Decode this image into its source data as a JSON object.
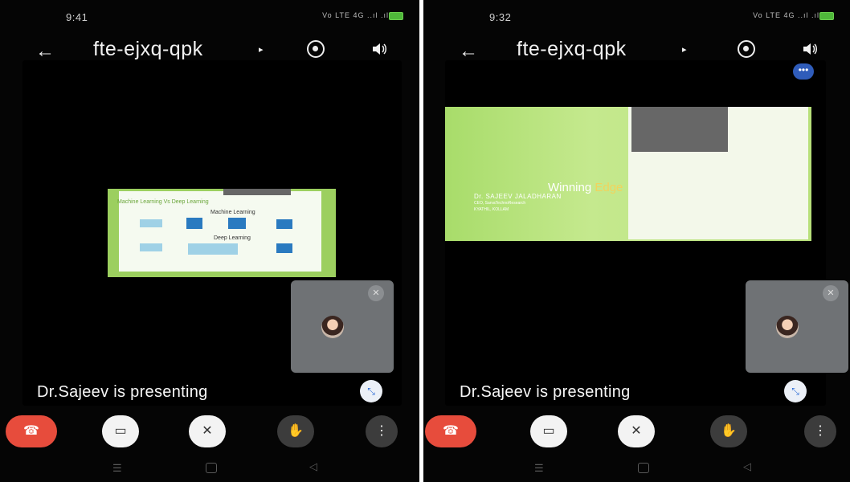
{
  "left": {
    "status": {
      "time": "9:41",
      "signal_text": "Vo LTE 4G ..ıl .ıl"
    },
    "meeting_code": "fte-ejxq-qpk",
    "title_caret": "▸",
    "slide": {
      "heading": "Machine Learning Vs Deep Learning",
      "row1_label": "Machine Learning",
      "row2_label": "Deep Learning"
    },
    "presenting_text": "Dr.Sajeev is presenting"
  },
  "right": {
    "status": {
      "time": "9:32",
      "signal_text": "Vo LTE 4G ..ıl .ıl"
    },
    "meeting_code": "fte-ejxq-qpk",
    "title_caret": "▸",
    "overflow_label": "•••",
    "slide": {
      "headline_white": "Winning ",
      "headline_gold": "Edge",
      "presenter": "Dr. SAJEEV JALADHARAN",
      "line2": "CEO, SarvaTechnoResearch",
      "line3": "KYATHIL, KOLLAM"
    },
    "presenting_text": "Dr.Sajeev is presenting"
  },
  "icons": {
    "back": "←",
    "mic_off": "✕",
    "hand": "✋",
    "more": "⋮",
    "recent": "☰",
    "nav_back": "◁",
    "end_call": "☎",
    "video_off": "▭",
    "fullscreen": "⤡"
  },
  "colors": {
    "end_call": "#e74c3c",
    "accent_blue": "#2f5cba",
    "slide_green": "#a5d56a"
  }
}
